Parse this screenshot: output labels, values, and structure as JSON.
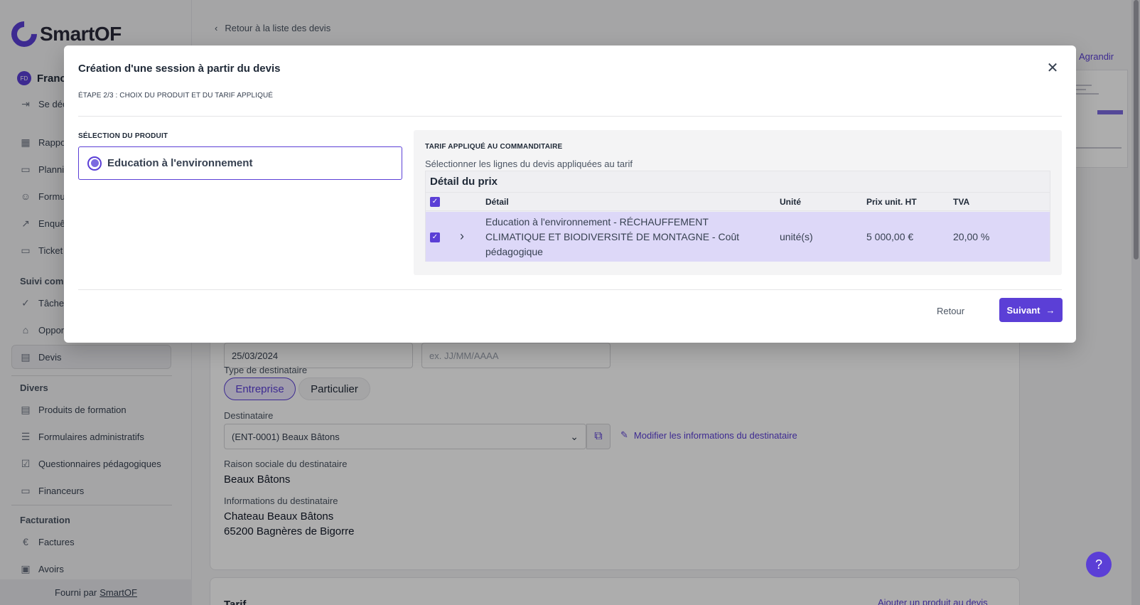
{
  "sidebar": {
    "logo_text": "SmartOF",
    "user_initials": "FD",
    "user_name": "Franc",
    "logout_label": "Se déc",
    "items": [
      {
        "label": "Rappo",
        "icon": "table-icon"
      },
      {
        "label": "Plannin",
        "icon": "calendar-icon"
      },
      {
        "label": "Formu",
        "icon": "users-icon"
      },
      {
        "label": "Enquê",
        "icon": "chart-icon"
      },
      {
        "label": "Ticket",
        "icon": "ticket-icon"
      }
    ],
    "section_suivi": "Suivi comm",
    "suivi_items": [
      {
        "label": "Tâches",
        "icon": "check-circle-icon"
      },
      {
        "label": "Opport",
        "icon": "tag-icon"
      },
      {
        "label": "Devis",
        "icon": "document-icon"
      }
    ],
    "section_divers": "Divers",
    "divers_items": [
      {
        "label": "Produits de formation",
        "icon": "document-icon"
      },
      {
        "label": "Formulaires administratifs",
        "icon": "list-icon"
      },
      {
        "label": "Questionnaires pédagogiques",
        "icon": "checkbox-icon"
      },
      {
        "label": "Financeurs",
        "icon": "card-icon"
      }
    ],
    "section_facturation": "Facturation",
    "facturation_items": [
      {
        "label": "Factures",
        "icon": "euro-icon"
      },
      {
        "label": "Avoirs",
        "icon": "money-icon"
      }
    ],
    "footer_prefix": "Fourni par",
    "footer_link": "SmartOF"
  },
  "page": {
    "back_link": "Retour à la liste des devis",
    "agrandir": "Agrandir",
    "date_value": "25/03/2024",
    "date_placeholder": "ex. JJ/MM/AAAA",
    "type_label": "Type de destinataire",
    "type_options": [
      "Entreprise",
      "Particulier"
    ],
    "type_selected": "Entreprise",
    "destinataire_label": "Destinataire",
    "destinataire_value": "(ENT-0001) Beaux Bâtons",
    "modify_link": "Modifier les informations du destinataire",
    "raison_label": "Raison sociale du destinataire",
    "raison_value": "Beaux Bâtons",
    "info_label": "Informations du destinataire",
    "info_line1": "Chateau Beaux Bâtons",
    "info_line2": "65200 Bagnères de Bigorre",
    "tarif_title": "Tarif",
    "add_product": "Ajouter un produit au devis",
    "help": "?"
  },
  "modal": {
    "title": "Création d'une session à partir du devis",
    "step": "ÉTAPE 2/3 : CHOIX DU PRODUIT ET DU TARIF APPLIQUÉ",
    "product_section": "SÉLECTION DU PRODUIT",
    "product_option": "Education à l'environnement",
    "tarif_section": "TARIF APPLIQUÉ AU COMMANDITAIRE",
    "tarif_subtitle": "Sélectionner les lignes du devis appliquées au tarif",
    "price_table": {
      "title": "Détail du prix",
      "columns": [
        "Détail",
        "Unité",
        "Prix unit. HT",
        "TVA"
      ],
      "rows": [
        {
          "detail_line1": "Education à l'environnement - RÉCHAUFFEMENT",
          "detail_line2": "CLIMATIQUE ET BIODIVERSITÉ DE MONTAGNE - Coût",
          "detail_line3": "pédagogique",
          "unit": "unité(s)",
          "price": "5 000,00 €",
          "tva": "20,00 %",
          "checked": true
        }
      ]
    },
    "back_label": "Retour",
    "next_label": "Suivant"
  },
  "colors": {
    "accent": "#5b3fd6",
    "row_selected": "#ddd8f8",
    "overlay": "rgba(0,0,0,0.32)"
  }
}
